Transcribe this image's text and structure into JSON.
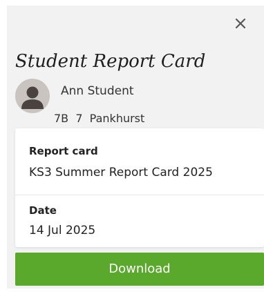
{
  "dialog": {
    "close_icon": "close-icon",
    "title": "Student Report Card"
  },
  "student": {
    "name": "Ann Student",
    "meta": "7B  7  Pankhurst",
    "avatar_icon": "person-icon"
  },
  "report": {
    "report_card_label": "Report card",
    "report_card_value": "KS3 Summer Report Card 2025",
    "date_label": "Date",
    "date_value": "14 Jul 2025"
  },
  "actions": {
    "download_label": "Download"
  },
  "colors": {
    "panel_background": "#f2f2f2",
    "download_button": "#5aa82c",
    "text": "#222222"
  }
}
